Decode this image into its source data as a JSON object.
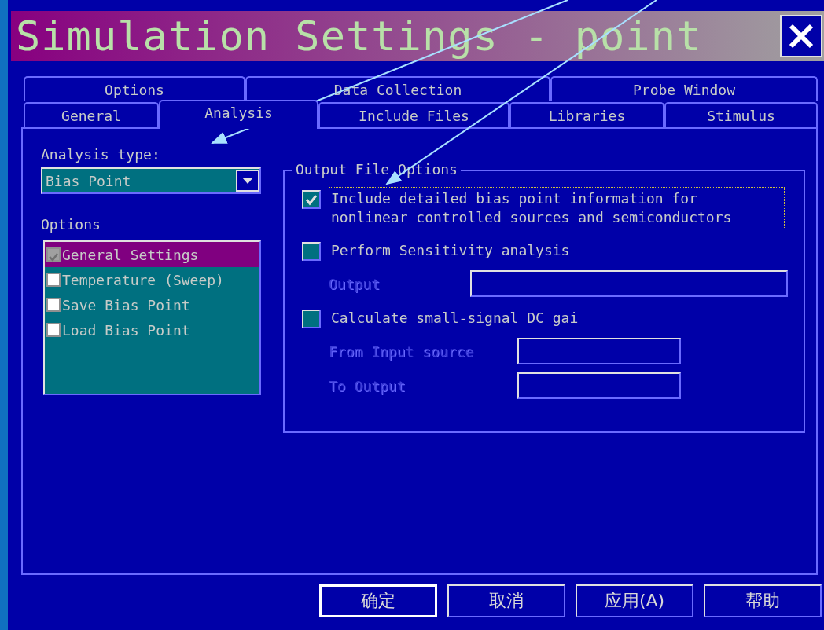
{
  "window": {
    "title": "Simulation Settings - point"
  },
  "tab_rows": [
    [
      {
        "label": "Options",
        "selected": false
      },
      {
        "label": "Data Collection",
        "selected": false
      },
      {
        "label": "Probe Window",
        "selected": false
      }
    ],
    [
      {
        "label": "General",
        "selected": false
      },
      {
        "label": "Analysis",
        "selected": true
      },
      {
        "label": "Include Files",
        "selected": false
      },
      {
        "label": "Libraries",
        "selected": false
      },
      {
        "label": "Stimulus",
        "selected": false
      }
    ]
  ],
  "analysis_type": {
    "label": "Analysis type:",
    "value": "Bias Point"
  },
  "options": {
    "label": "Options",
    "items": [
      {
        "label": "General Settings",
        "checked": true,
        "disabled": true,
        "selected": true
      },
      {
        "label": "Temperature (Sweep)",
        "checked": false,
        "disabled": false,
        "selected": false
      },
      {
        "label": "Save Bias Point",
        "checked": false,
        "disabled": false,
        "selected": false
      },
      {
        "label": "Load Bias Point",
        "checked": false,
        "disabled": false,
        "selected": false
      }
    ]
  },
  "output_group": {
    "title": "Output File Options",
    "items": [
      {
        "label": "Include detailed bias point information for nonlinear controlled sources and semiconductors",
        "checked": true,
        "focused": true
      },
      {
        "label": "Perform Sensitivity analysis",
        "checked": false,
        "focused": false,
        "fields": [
          {
            "label": "Output",
            "disabled": true
          }
        ]
      },
      {
        "label": "Calculate small-signal DC gai",
        "checked": false,
        "focused": false,
        "fields": [
          {
            "label": "From Input source",
            "disabled": true
          },
          {
            "label": "To Output",
            "disabled": true
          }
        ]
      }
    ]
  },
  "buttons": [
    {
      "label": "确定",
      "default": true
    },
    {
      "label": "取消",
      "default": false
    },
    {
      "label": "应用(A)",
      "default": false
    },
    {
      "label": "帮助",
      "default": false
    }
  ]
}
